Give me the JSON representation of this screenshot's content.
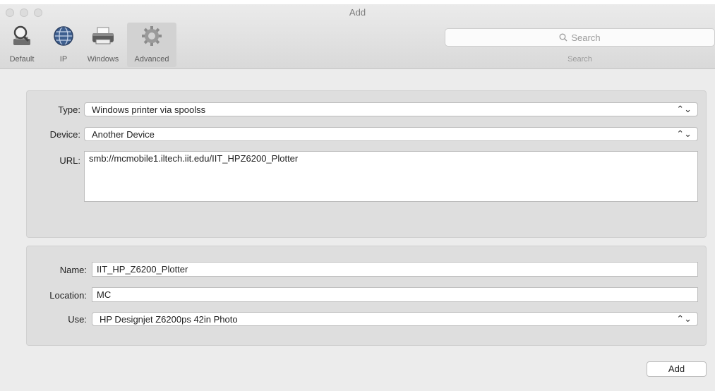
{
  "window": {
    "title": "Add"
  },
  "toolbar": {
    "items": [
      {
        "label": "Default",
        "icon": "magnifier-printer-icon"
      },
      {
        "label": "IP",
        "icon": "globe-icon"
      },
      {
        "label": "Windows",
        "icon": "printer-icon"
      },
      {
        "label": "Advanced",
        "icon": "gear-icon",
        "selected": true
      }
    ],
    "search": {
      "placeholder": "Search",
      "caption": "Search"
    }
  },
  "connection": {
    "type_label": "Type:",
    "type_value": "Windows printer via spoolss",
    "device_label": "Device:",
    "device_value": "Another Device",
    "url_label": "URL:",
    "url_value": "smb://mcmobile1.iltech.iit.edu/IIT_HPZ6200_Plotter"
  },
  "details": {
    "name_label": "Name:",
    "name_value": "IIT_HP_Z6200_Plotter",
    "location_label": "Location:",
    "location_value": "MC",
    "use_label": "Use:",
    "use_value": "HP Designjet Z6200ps 42in Photo"
  },
  "footer": {
    "add_label": "Add"
  }
}
